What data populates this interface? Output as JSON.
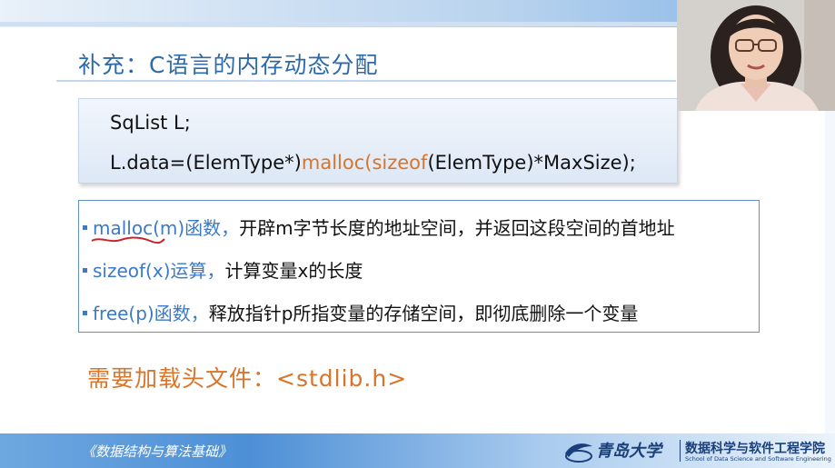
{
  "slide": {
    "title": "补充：C语言的内存动态分配",
    "code": {
      "line1": "SqList L;",
      "line2_prefix": "L.data=(ElemType*)",
      "line2_malloc": "malloc",
      "line2_paren": "(",
      "line2_sizeof": "sizeof",
      "line2_suffix": "(ElemType)*MaxSize);"
    },
    "bullets": [
      {
        "term": "malloc(m)函数，",
        "desc": "开辟m字节长度的地址空间，并返回这段空间的首地址"
      },
      {
        "term": "sizeof(x)运算，",
        "desc": "计算变量x的长度"
      },
      {
        "term": "free(p)函数，",
        "desc": "释放指针p所指变量的存储空间，即彻底删除一个变量"
      }
    ],
    "note": "需要加载头文件：<stdlib.h>"
  },
  "footer": {
    "course_name": "《数据结构与算法基础》",
    "university_name": "青岛大学",
    "school_cn": "数据科学与软件工程学院",
    "school_en": "School of Data Science and Software Engineering"
  },
  "colors": {
    "accent_blue": "#3b7ac6",
    "accent_orange": "#d9742a",
    "title_blue": "#2f6aa8",
    "underline_red": "#c8242b"
  },
  "icons": [
    "university-emblem-icon",
    "bullet-square-icon"
  ]
}
